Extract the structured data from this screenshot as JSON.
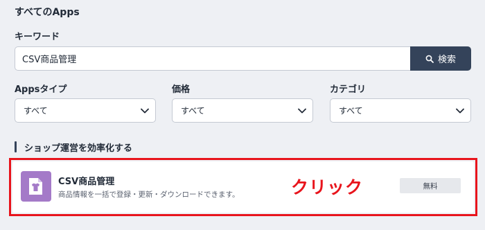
{
  "page": {
    "title": "すべてのApps"
  },
  "search": {
    "label": "キーワード",
    "value": "CSV商品管理",
    "button_label": "検索",
    "button_icon": "search-icon"
  },
  "filters": [
    {
      "label": "Appsタイプ",
      "selected": "すべて"
    },
    {
      "label": "価格",
      "selected": "すべて"
    },
    {
      "label": "カテゴリ",
      "selected": "すべて"
    }
  ],
  "section": {
    "heading": "ショップ運営を効率化する"
  },
  "apps": [
    {
      "name": "CSV商品管理",
      "description": "商品情報を一括で登録・更新・ダウンロードできます。",
      "price": "無料",
      "icon": "clothing-document-icon"
    }
  ],
  "annotation": {
    "text": "クリック",
    "color": "#e8141c"
  },
  "colors": {
    "background": "#eef0f4",
    "primary_button": "#34435a",
    "app_icon_bg": "#a47ac8",
    "highlight": "#e8141c"
  }
}
